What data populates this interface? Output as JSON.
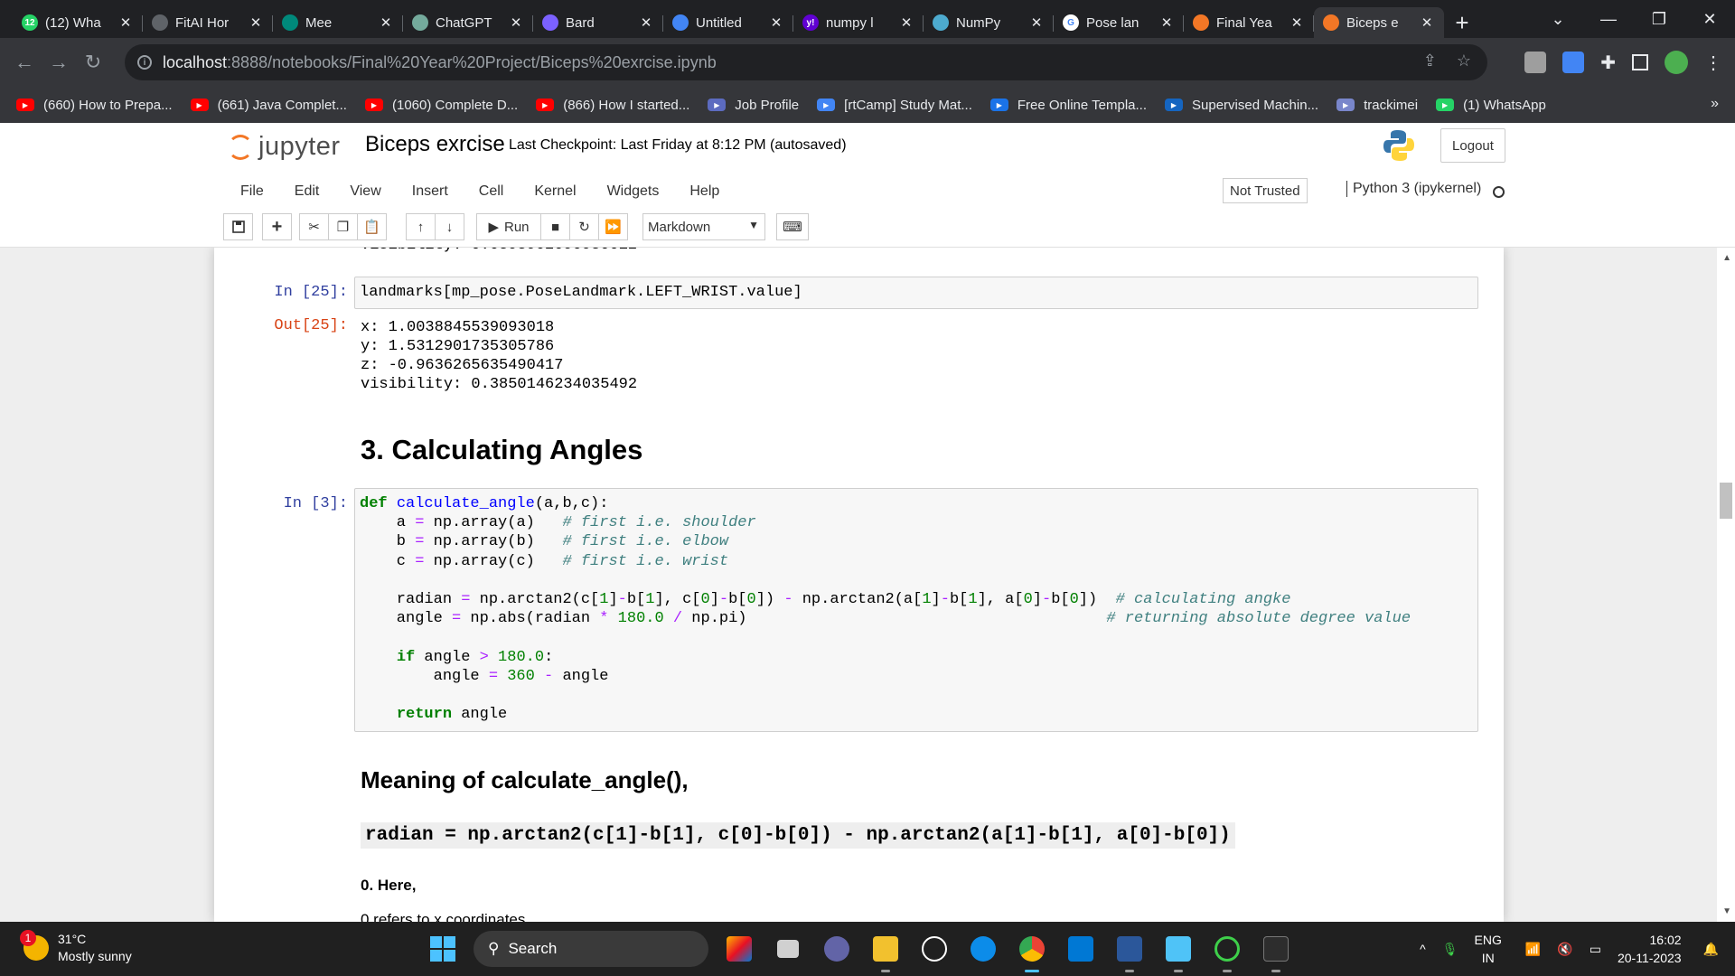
{
  "browser": {
    "tabs": [
      {
        "title": "(12) Wha",
        "fav_color": "#25d366",
        "fav_text": "12"
      },
      {
        "title": "FitAI Hor",
        "fav_color": "#5f6368",
        "fav_text": ""
      },
      {
        "title": "Mee",
        "fav_color": "#00897b",
        "fav_text": ""
      },
      {
        "title": "ChatGPT",
        "fav_color": "#74aa9c",
        "fav_text": ""
      },
      {
        "title": "Bard",
        "fav_color": "#7b61ff",
        "fav_text": ""
      },
      {
        "title": "Untitled",
        "fav_color": "#4285f4",
        "fav_text": ""
      },
      {
        "title": "numpy l",
        "fav_color": "#6001d2",
        "fav_text": "y!"
      },
      {
        "title": "NumPy",
        "fav_color": "#4dabcf",
        "fav_text": ""
      },
      {
        "title": "Pose lan",
        "fav_color": "#ffffff",
        "fav_text": "G"
      },
      {
        "title": "Final Yea",
        "fav_color": "#f37726",
        "fav_text": ""
      },
      {
        "title": "Biceps e",
        "fav_color": "#f37726",
        "fav_text": ""
      }
    ],
    "url_host": "localhost",
    "url_path": ":8888/notebooks/Final%20Year%20Project/Biceps%20exrcise.ipynb",
    "bookmarks": [
      {
        "label": "(660) How to Prepa...",
        "color": "#ff0000"
      },
      {
        "label": "(661) Java Complet...",
        "color": "#ff0000"
      },
      {
        "label": "(1060) Complete D...",
        "color": "#ff0000"
      },
      {
        "label": "(866) How I started...",
        "color": "#ff0000"
      },
      {
        "label": "Job Profile",
        "color": "#5c6bc0"
      },
      {
        "label": "[rtCamp] Study Mat...",
        "color": "#4285f4"
      },
      {
        "label": "Free Online Templa...",
        "color": "#1a73e8"
      },
      {
        "label": "Supervised Machin...",
        "color": "#1565c0"
      },
      {
        "label": "trackimei",
        "color": "#7986cb"
      },
      {
        "label": "(1) WhatsApp",
        "color": "#25d366"
      }
    ],
    "bookmarks_more": "»"
  },
  "jupyter": {
    "logo_text": "jupyter",
    "notebook_title": "Biceps exrcise",
    "checkpoint": "Last Checkpoint: Last Friday at 8:12 PM  (autosaved)",
    "logout": "Logout",
    "menu": [
      "File",
      "Edit",
      "View",
      "Insert",
      "Cell",
      "Kernel",
      "Widgets",
      "Help"
    ],
    "not_trusted": "Not Trusted",
    "kernel": "Python 3 (ipykernel)",
    "run_label": "Run",
    "cell_type": "Markdown"
  },
  "cells": {
    "cell25_in_prompt": "In [25]:",
    "cell25_code": "landmarks[mp_pose.PoseLandmark.LEFT_WRIST.value]",
    "cell25_out_prompt": "Out[25]:",
    "cell25_output": "x: 1.0038845539093018\ny: 1.5312901735305786\nz: -0.9636265635490417\nvisibility: 0.3850146234035492",
    "section_heading": "3. Calculating Angles",
    "cell3_in_prompt": "In [3]:",
    "meaning_heading": "Meaning of calculate_angle(),",
    "meaning_code": "radian = np.arctan2(c[1]-b[1], c[0]-b[0]) - np.arctan2(a[1]-b[1], a[0]-b[0])",
    "here_text": "0. Here,",
    "refers_text": "0 refers to x coordinates"
  },
  "taskbar": {
    "temperature": "31°C",
    "weather": "Mostly sunny",
    "weather_badge": "1",
    "search": "Search",
    "lang1": "ENG",
    "lang2": "IN",
    "time": "16:02",
    "date": "20-11-2023"
  }
}
